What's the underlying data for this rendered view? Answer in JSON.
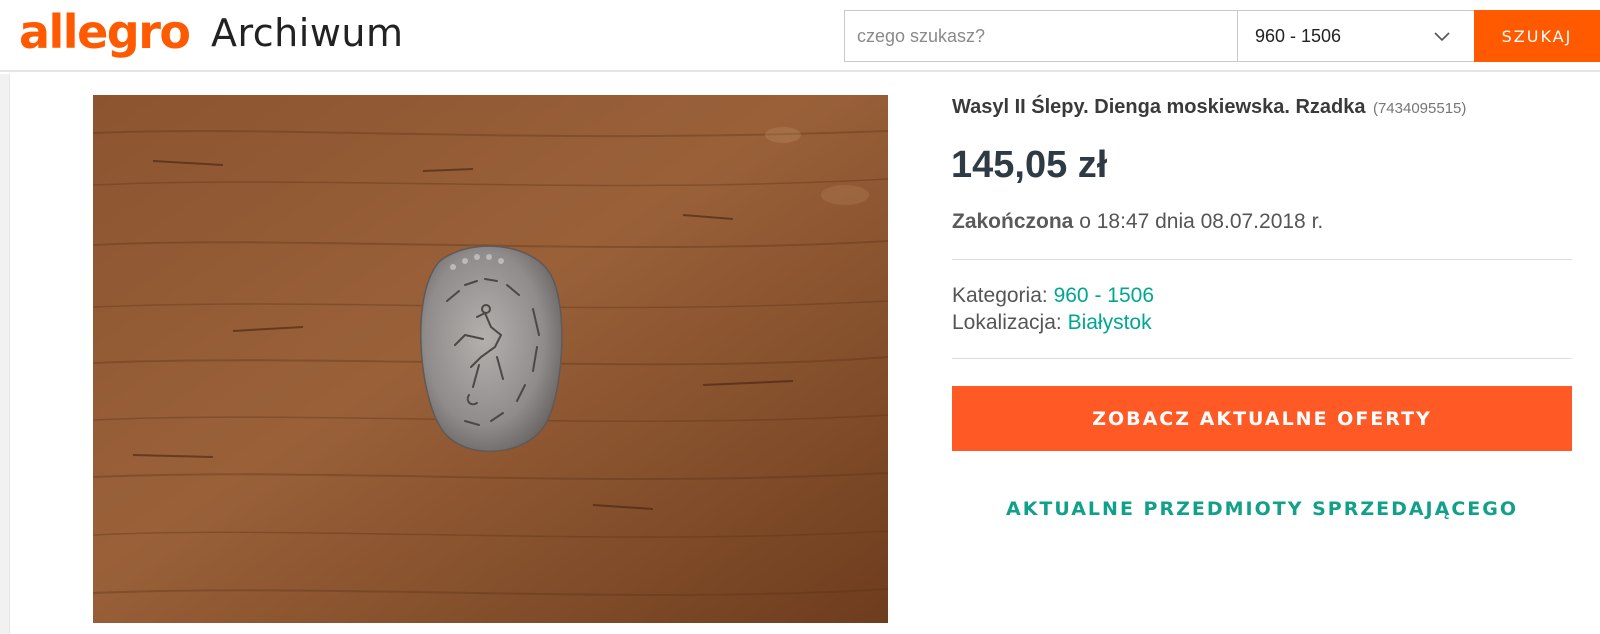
{
  "header": {
    "logo_text": "allegro",
    "section_title": "Archiwum",
    "search": {
      "placeholder": "czego szukasz?",
      "value": ""
    },
    "category_select": {
      "selected": "960 - 1506",
      "icon": "chevron-down-icon"
    },
    "search_button_label": "SZUKAJ"
  },
  "listing": {
    "photo": {
      "description_icon": "coin-photo"
    },
    "title": "Wasyl II Ślepy. Dienga moskiewska. Rzadka",
    "item_id": "(7434095515)",
    "price": "145,05 zł",
    "status": {
      "label": "Zakończona",
      "detail": " o 18:47 dnia 08.07.2018 r."
    },
    "category": {
      "label": "Kategoria: ",
      "value": "960 - 1506"
    },
    "location": {
      "label": "Lokalizacja: ",
      "value": "Białystok"
    },
    "offers_button_label": "ZOBACZ AKTUALNE OFERTY",
    "seller_link_label": "AKTUALNE PRZEDMIOTY SPRZEDAJĄCEGO"
  },
  "colors": {
    "brand": "#ff5a00",
    "cta": "#ff5a26",
    "link": "#00a790",
    "price": "#2e3a44"
  }
}
